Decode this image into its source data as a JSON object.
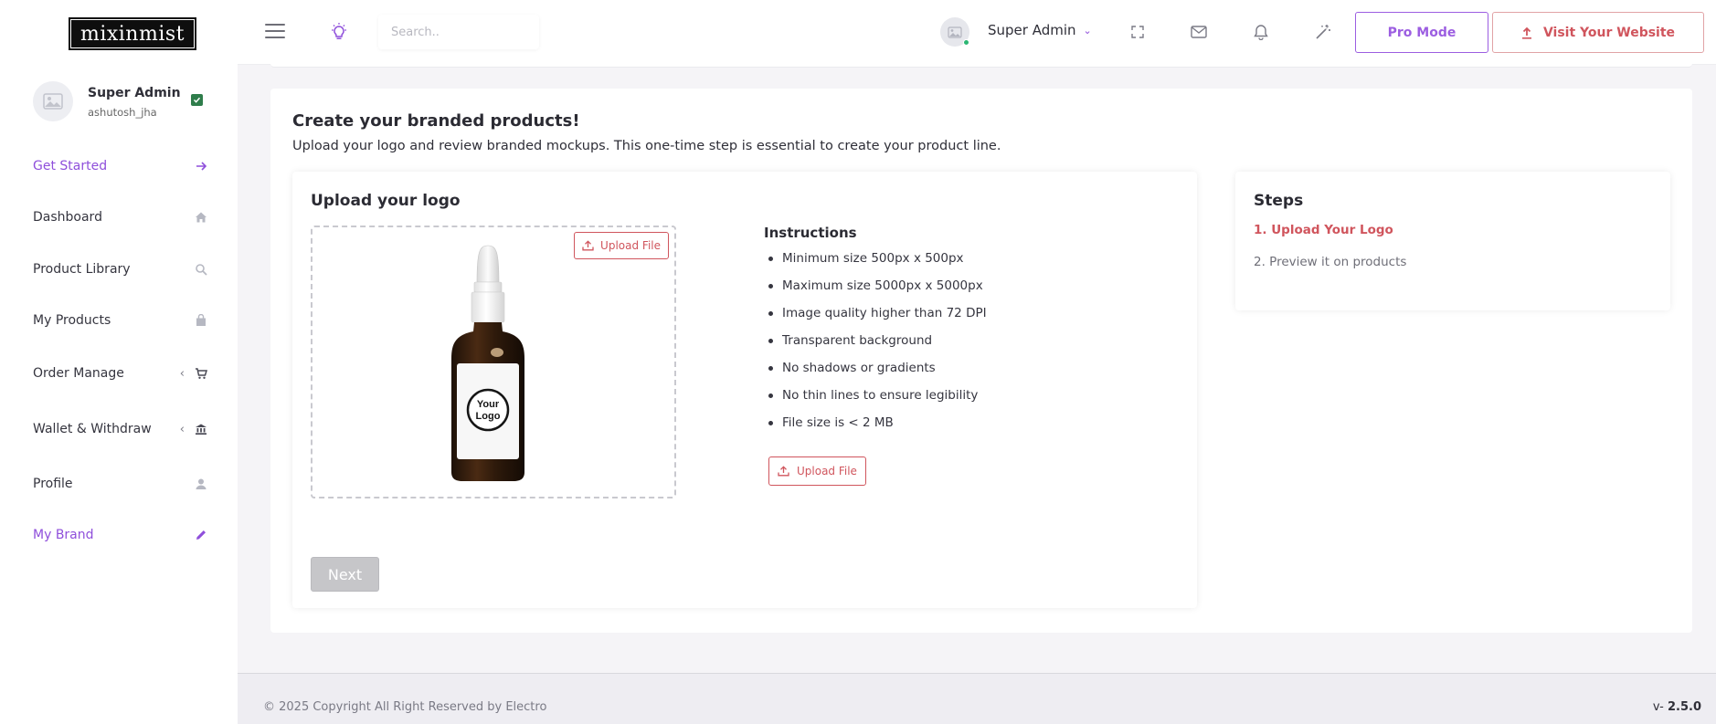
{
  "brand": {
    "logo_text": "mixinmist"
  },
  "sidebar": {
    "profile": {
      "name": "Super Admin",
      "username": "ashutosh_jha"
    },
    "items": [
      {
        "label": "Get Started",
        "icon": "arrow-right-icon"
      },
      {
        "label": "Dashboard",
        "icon": "home-icon"
      },
      {
        "label": "Product Library",
        "icon": "search-icon"
      },
      {
        "label": "My Products",
        "icon": "bag-icon"
      },
      {
        "label": "Order Manage",
        "icon": "cart-icon",
        "chevron": "‹"
      },
      {
        "label": "Wallet & Withdraw",
        "icon": "bank-icon",
        "chevron": "‹"
      },
      {
        "label": "Profile",
        "icon": "person-icon"
      },
      {
        "label": "My Brand",
        "icon": "pencil-icon"
      }
    ]
  },
  "header": {
    "search_placeholder": "Search..",
    "user_name": "Super Admin",
    "dropdown_caret": "⌄",
    "pro_mode_label": "Pro Mode",
    "visit_label": "Visit Your Website"
  },
  "main": {
    "title": "Create your branded products!",
    "subtitle": "Upload your logo and review branded mockups. This one-time step is essential to create your product line.",
    "upload": {
      "title": "Upload your logo",
      "upload_label": "Upload File",
      "bottle_label_line1": "Your",
      "bottle_label_line2": "Logo",
      "instructions_title": "Instructions",
      "instructions": [
        "Minimum size 500px x 500px",
        "Maximum size 5000px x 5000px",
        "Image quality higher than 72 DPI",
        "Transparent background",
        "No shadows or gradients",
        "No thin lines to ensure legibility",
        "File size is < 2 MB"
      ],
      "upload_label_2": "Upload File",
      "next_label": "Next"
    },
    "steps": {
      "title": "Steps",
      "step1": "1. Upload Your Logo",
      "step2": "2. Preview it on products"
    }
  },
  "footer": {
    "copyright": "© 2025 Copyright All Right Reserved by Electro",
    "version_prefix": "v- ",
    "version": "2.5.0"
  },
  "colors": {
    "accent_purple": "#8f4fdb",
    "accent_red": "#d0555d",
    "step_active": "#d0555d",
    "online": "#2bb673"
  }
}
